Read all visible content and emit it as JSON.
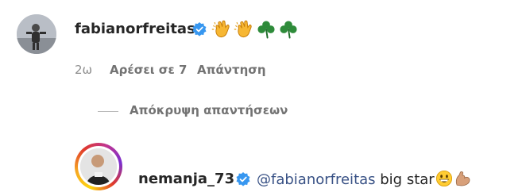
{
  "comment": {
    "username": "fabianorfreitas",
    "emojis": [
      "clapping-hands",
      "clapping-hands",
      "shamrock",
      "shamrock"
    ],
    "time": "2ω",
    "likes": "Αρέσει σε 7",
    "reply_label": "Απάντηση"
  },
  "replies_toggle": {
    "label": "Απόκρυψη απαντήσεων"
  },
  "reply": {
    "username": "nemanja_73",
    "mention": "@fabianorfreitas",
    "text": " big star",
    "emojis": [
      "grinning-face",
      "flexed-biceps"
    ]
  },
  "colors": {
    "verified_blue": "#3797f0",
    "mention_blue": "#385185",
    "meta_gray": "#8e8e8e"
  }
}
